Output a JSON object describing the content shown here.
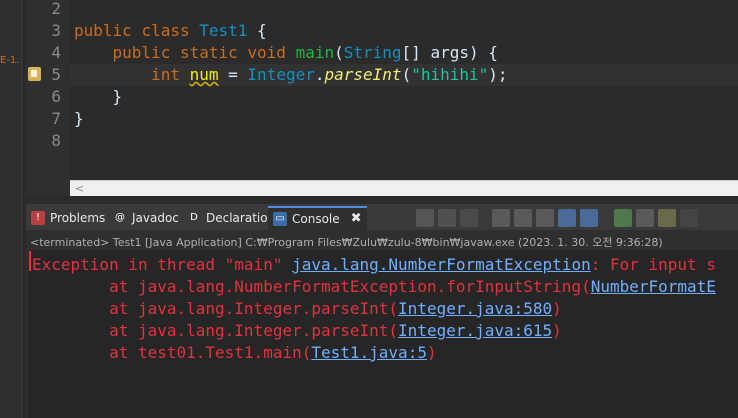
{
  "left_panel": {
    "fragment": "E-1."
  },
  "editor": {
    "lines": [
      {
        "num": "2",
        "parts": []
      },
      {
        "num": "3",
        "parts": [
          {
            "t": "public",
            "c": "kw"
          },
          {
            "t": " ",
            "c": "plain"
          },
          {
            "t": "class",
            "c": "kw"
          },
          {
            "t": " ",
            "c": "plain"
          },
          {
            "t": "Test1",
            "c": "cls"
          },
          {
            "t": " {",
            "c": "plain"
          }
        ]
      },
      {
        "num": "4",
        "parts": [
          {
            "t": "    ",
            "c": "plain"
          },
          {
            "t": "public",
            "c": "kw"
          },
          {
            "t": " ",
            "c": "plain"
          },
          {
            "t": "static",
            "c": "kw"
          },
          {
            "t": " ",
            "c": "plain"
          },
          {
            "t": "void",
            "c": "kw"
          },
          {
            "t": " ",
            "c": "plain"
          },
          {
            "t": "main",
            "c": "mth"
          },
          {
            "t": "(",
            "c": "plain"
          },
          {
            "t": "String",
            "c": "cls"
          },
          {
            "t": "[] ",
            "c": "plain"
          },
          {
            "t": "args",
            "c": "plain"
          },
          {
            "t": ") {",
            "c": "plain"
          }
        ]
      },
      {
        "num": "5",
        "parts": [
          {
            "t": "        ",
            "c": "plain"
          },
          {
            "t": "int",
            "c": "kw"
          },
          {
            "t": " ",
            "c": "plain"
          },
          {
            "t": "num",
            "c": "var"
          },
          {
            "t": " = ",
            "c": "plain"
          },
          {
            "t": "Integer",
            "c": "cls"
          },
          {
            "t": ".",
            "c": "plain"
          },
          {
            "t": "parseInt",
            "c": "fld it"
          },
          {
            "t": "(",
            "c": "plain"
          },
          {
            "t": "\"hihihi\"",
            "c": "str"
          },
          {
            "t": ");",
            "c": "plain"
          }
        ]
      },
      {
        "num": "6",
        "parts": [
          {
            "t": "    }",
            "c": "plain"
          }
        ]
      },
      {
        "num": "7",
        "parts": [
          {
            "t": "}",
            "c": "plain"
          }
        ]
      },
      {
        "num": "8",
        "parts": []
      }
    ],
    "scroll_arrow": "<"
  },
  "console": {
    "tabs": [
      {
        "label": "Problems",
        "icon": "problems-icon"
      },
      {
        "label": "Javadoc",
        "icon": "javadoc-icon"
      },
      {
        "label": "Declaration",
        "icon": "declaration-icon"
      },
      {
        "label": "Console",
        "icon": "console-icon",
        "active": true
      }
    ],
    "terminated": "<terminated> Test1 [Java Application] C:₩Program Files₩Zulu₩zulu-8₩bin₩javaw.exe (2023. 1. 30. 오전 9:36:28)",
    "output": [
      [
        {
          "t": "Exception in thread \"main\" ",
          "l": false
        },
        {
          "t": "java.lang.NumberFormatException",
          "l": true
        },
        {
          "t": ": For input s",
          "l": false
        }
      ],
      [
        {
          "t": "        at java.lang.NumberFormatException.forInputString(",
          "l": false
        },
        {
          "t": "NumberFormatE",
          "l": true
        }
      ],
      [
        {
          "t": "        at java.lang.Integer.parseInt(",
          "l": false
        },
        {
          "t": "Integer.java:580",
          "l": true
        },
        {
          "t": ")",
          "l": false
        }
      ],
      [
        {
          "t": "        at java.lang.Integer.parseInt(",
          "l": false
        },
        {
          "t": "Integer.java:615",
          "l": true
        },
        {
          "t": ")",
          "l": false
        }
      ],
      [
        {
          "t": "        at test01.Test1.main(",
          "l": false
        },
        {
          "t": "Test1.java:5",
          "l": true
        },
        {
          "t": ")",
          "l": false
        }
      ]
    ]
  },
  "colors": {
    "keyword": "#cc6c1d",
    "class": "#1290c3",
    "string": "#17c6a3",
    "error": "#e3323e",
    "link": "#6fb0ff"
  }
}
